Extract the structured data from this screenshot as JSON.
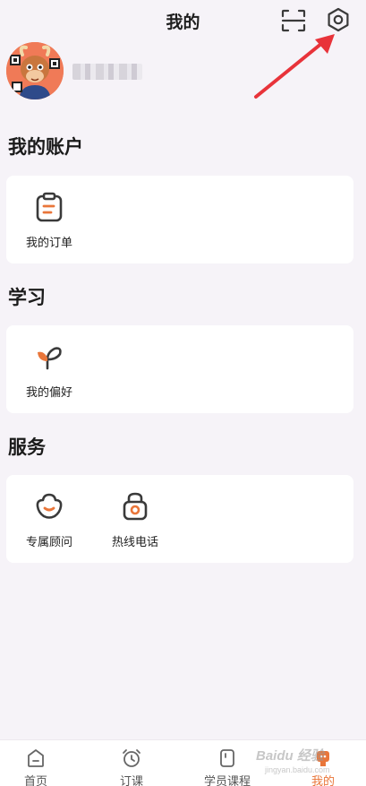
{
  "header": {
    "title": "我的",
    "scan_icon": "scan-icon",
    "settings_icon": "settings-gear-icon"
  },
  "profile": {
    "avatar_icon": "avatar-cartoon-bull",
    "username": "████"
  },
  "sections": [
    {
      "title": "我的账户",
      "items": [
        {
          "label": "我的订单",
          "icon": "clipboard-order-icon"
        }
      ]
    },
    {
      "title": "学习",
      "items": [
        {
          "label": "我的偏好",
          "icon": "sprout-icon"
        }
      ]
    },
    {
      "title": "服务",
      "items": [
        {
          "label": "专属顾问",
          "icon": "advisor-flower-icon"
        },
        {
          "label": "热线电话",
          "icon": "telephone-icon"
        }
      ]
    }
  ],
  "tabbar": {
    "tabs": [
      {
        "label": "首页",
        "icon": "home-icon",
        "active": false
      },
      {
        "label": "订课",
        "icon": "alarm-clock-icon",
        "active": false
      },
      {
        "label": "学员课程",
        "icon": "course-book-icon",
        "active": false
      },
      {
        "label": "我的",
        "icon": "profile-icon",
        "active": true
      }
    ]
  },
  "colors": {
    "accent": "#e9763a",
    "icon_dark": "#3a3a3a",
    "background": "#f6f3f8",
    "card": "#ffffff",
    "annotation_arrow": "#e8333a"
  },
  "watermark": {
    "text": "Baidu 经验",
    "sub": "jingyan.baidu.com"
  }
}
